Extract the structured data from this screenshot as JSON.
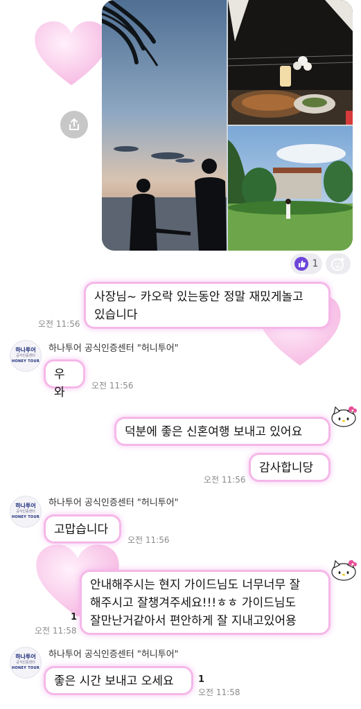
{
  "reactions": {
    "like_count": "1"
  },
  "messages": [
    {
      "id": "m1",
      "lines": [
        "사장님~ 카오락 있는동안 정말 재밌게놀고",
        "있습니다"
      ],
      "time": "오전 11:56"
    },
    {
      "id": "m2",
      "sender": "하나투어 공식인증센터 \"허니투어\"",
      "text": "우와",
      "time": "오전 11:56"
    },
    {
      "id": "m3",
      "text": "덕분에 좋은 신혼여행 보내고 있어요"
    },
    {
      "id": "m4",
      "text": "감사합니당",
      "time": "오전 11:56"
    },
    {
      "id": "m5",
      "sender": "하나투어 공식인증센터 \"허니투어\"",
      "text": "고맙습니다",
      "time": "오전 11:56"
    },
    {
      "id": "m6",
      "lines": [
        "안내해주시는 현지 가이드님도 너무너무 잘",
        "해주시고 잘챙겨주세요!!!ㅎㅎ 가이드님도",
        "잘만난거같아서 편안하게 잘 지내고있어용"
      ],
      "unread": "1",
      "time": "오전 11:58"
    },
    {
      "id": "m7",
      "sender": "하나투어 공식인증센터 \"허니투어\"",
      "text": "좋은 시간 보내고 오세요",
      "unread": "1",
      "time": "오전 11:58"
    }
  ],
  "avatar": {
    "logo": "하나투어",
    "sub": "공식인증센터",
    "brand": "HONEY TOUR"
  },
  "icons": {
    "share": "share-icon",
    "like": "thumbs-up-icon",
    "add_reaction": "add-emoji-icon",
    "hearts": "pink-heart-icon",
    "sticker": "hello-kitty-icon"
  },
  "colors": {
    "bubble_glow": "#f5b7e8",
    "heart": "#f7c3e6",
    "like": "#6d45d9"
  }
}
